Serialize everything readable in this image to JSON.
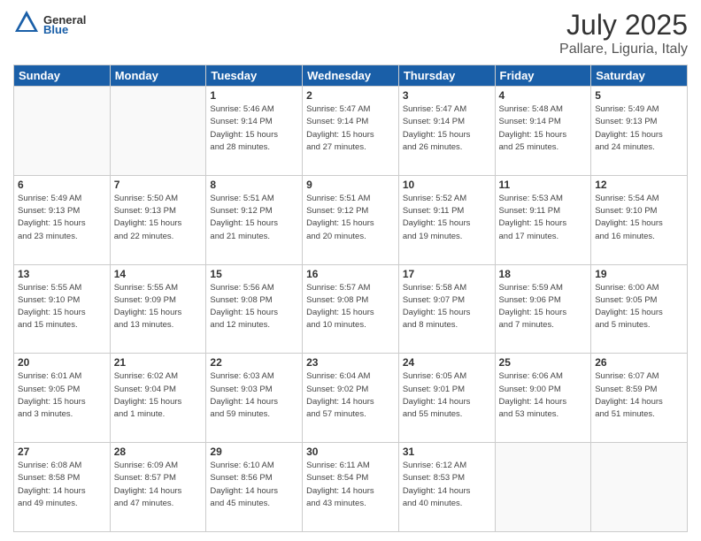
{
  "header": {
    "logo_general": "General",
    "logo_blue": "Blue",
    "month_title": "July 2025",
    "location": "Pallare, Liguria, Italy"
  },
  "days_of_week": [
    "Sunday",
    "Monday",
    "Tuesday",
    "Wednesday",
    "Thursday",
    "Friday",
    "Saturday"
  ],
  "weeks": [
    [
      {
        "day": "",
        "info": ""
      },
      {
        "day": "",
        "info": ""
      },
      {
        "day": "1",
        "info": "Sunrise: 5:46 AM\nSunset: 9:14 PM\nDaylight: 15 hours\nand 28 minutes."
      },
      {
        "day": "2",
        "info": "Sunrise: 5:47 AM\nSunset: 9:14 PM\nDaylight: 15 hours\nand 27 minutes."
      },
      {
        "day": "3",
        "info": "Sunrise: 5:47 AM\nSunset: 9:14 PM\nDaylight: 15 hours\nand 26 minutes."
      },
      {
        "day": "4",
        "info": "Sunrise: 5:48 AM\nSunset: 9:14 PM\nDaylight: 15 hours\nand 25 minutes."
      },
      {
        "day": "5",
        "info": "Sunrise: 5:49 AM\nSunset: 9:13 PM\nDaylight: 15 hours\nand 24 minutes."
      }
    ],
    [
      {
        "day": "6",
        "info": "Sunrise: 5:49 AM\nSunset: 9:13 PM\nDaylight: 15 hours\nand 23 minutes."
      },
      {
        "day": "7",
        "info": "Sunrise: 5:50 AM\nSunset: 9:13 PM\nDaylight: 15 hours\nand 22 minutes."
      },
      {
        "day": "8",
        "info": "Sunrise: 5:51 AM\nSunset: 9:12 PM\nDaylight: 15 hours\nand 21 minutes."
      },
      {
        "day": "9",
        "info": "Sunrise: 5:51 AM\nSunset: 9:12 PM\nDaylight: 15 hours\nand 20 minutes."
      },
      {
        "day": "10",
        "info": "Sunrise: 5:52 AM\nSunset: 9:11 PM\nDaylight: 15 hours\nand 19 minutes."
      },
      {
        "day": "11",
        "info": "Sunrise: 5:53 AM\nSunset: 9:11 PM\nDaylight: 15 hours\nand 17 minutes."
      },
      {
        "day": "12",
        "info": "Sunrise: 5:54 AM\nSunset: 9:10 PM\nDaylight: 15 hours\nand 16 minutes."
      }
    ],
    [
      {
        "day": "13",
        "info": "Sunrise: 5:55 AM\nSunset: 9:10 PM\nDaylight: 15 hours\nand 15 minutes."
      },
      {
        "day": "14",
        "info": "Sunrise: 5:55 AM\nSunset: 9:09 PM\nDaylight: 15 hours\nand 13 minutes."
      },
      {
        "day": "15",
        "info": "Sunrise: 5:56 AM\nSunset: 9:08 PM\nDaylight: 15 hours\nand 12 minutes."
      },
      {
        "day": "16",
        "info": "Sunrise: 5:57 AM\nSunset: 9:08 PM\nDaylight: 15 hours\nand 10 minutes."
      },
      {
        "day": "17",
        "info": "Sunrise: 5:58 AM\nSunset: 9:07 PM\nDaylight: 15 hours\nand 8 minutes."
      },
      {
        "day": "18",
        "info": "Sunrise: 5:59 AM\nSunset: 9:06 PM\nDaylight: 15 hours\nand 7 minutes."
      },
      {
        "day": "19",
        "info": "Sunrise: 6:00 AM\nSunset: 9:05 PM\nDaylight: 15 hours\nand 5 minutes."
      }
    ],
    [
      {
        "day": "20",
        "info": "Sunrise: 6:01 AM\nSunset: 9:05 PM\nDaylight: 15 hours\nand 3 minutes."
      },
      {
        "day": "21",
        "info": "Sunrise: 6:02 AM\nSunset: 9:04 PM\nDaylight: 15 hours\nand 1 minute."
      },
      {
        "day": "22",
        "info": "Sunrise: 6:03 AM\nSunset: 9:03 PM\nDaylight: 14 hours\nand 59 minutes."
      },
      {
        "day": "23",
        "info": "Sunrise: 6:04 AM\nSunset: 9:02 PM\nDaylight: 14 hours\nand 57 minutes."
      },
      {
        "day": "24",
        "info": "Sunrise: 6:05 AM\nSunset: 9:01 PM\nDaylight: 14 hours\nand 55 minutes."
      },
      {
        "day": "25",
        "info": "Sunrise: 6:06 AM\nSunset: 9:00 PM\nDaylight: 14 hours\nand 53 minutes."
      },
      {
        "day": "26",
        "info": "Sunrise: 6:07 AM\nSunset: 8:59 PM\nDaylight: 14 hours\nand 51 minutes."
      }
    ],
    [
      {
        "day": "27",
        "info": "Sunrise: 6:08 AM\nSunset: 8:58 PM\nDaylight: 14 hours\nand 49 minutes."
      },
      {
        "day": "28",
        "info": "Sunrise: 6:09 AM\nSunset: 8:57 PM\nDaylight: 14 hours\nand 47 minutes."
      },
      {
        "day": "29",
        "info": "Sunrise: 6:10 AM\nSunset: 8:56 PM\nDaylight: 14 hours\nand 45 minutes."
      },
      {
        "day": "30",
        "info": "Sunrise: 6:11 AM\nSunset: 8:54 PM\nDaylight: 14 hours\nand 43 minutes."
      },
      {
        "day": "31",
        "info": "Sunrise: 6:12 AM\nSunset: 8:53 PM\nDaylight: 14 hours\nand 40 minutes."
      },
      {
        "day": "",
        "info": ""
      },
      {
        "day": "",
        "info": ""
      }
    ]
  ]
}
